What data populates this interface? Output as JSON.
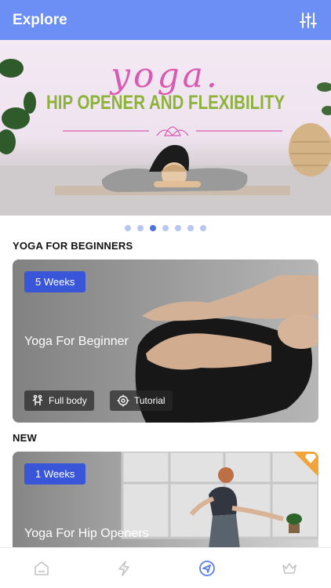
{
  "header": {
    "title": "Explore",
    "filter_icon": "sliders-icon"
  },
  "banner": {
    "script_text": "yoga.",
    "headline": "HIP OPENER AND FLEXIBILITY",
    "pager": {
      "count": 7,
      "active_index": 2
    }
  },
  "sections": [
    {
      "title": "YOGA FOR BEGINNERS",
      "card": {
        "badge": "5 Weeks",
        "title": "Yoga For Beginner",
        "chips": [
          {
            "icon": "body-icon",
            "label": "Full body"
          },
          {
            "icon": "target-icon",
            "label": "Tutorial"
          }
        ]
      }
    },
    {
      "title": "NEW",
      "card": {
        "badge": "1 Weeks",
        "title": "Yoga For Hip Openers",
        "premium_icon": "diamond-icon"
      }
    }
  ],
  "tabbar": {
    "items": [
      {
        "icon": "home-icon",
        "active": false
      },
      {
        "icon": "lightning-icon",
        "active": false
      },
      {
        "icon": "compass-icon",
        "active": true
      },
      {
        "icon": "crown-icon",
        "active": false
      }
    ]
  },
  "colors": {
    "accent": "#6b8ff5",
    "badge": "#3a56d8",
    "headline": "#8cb23a",
    "script": "#d95bb1"
  }
}
